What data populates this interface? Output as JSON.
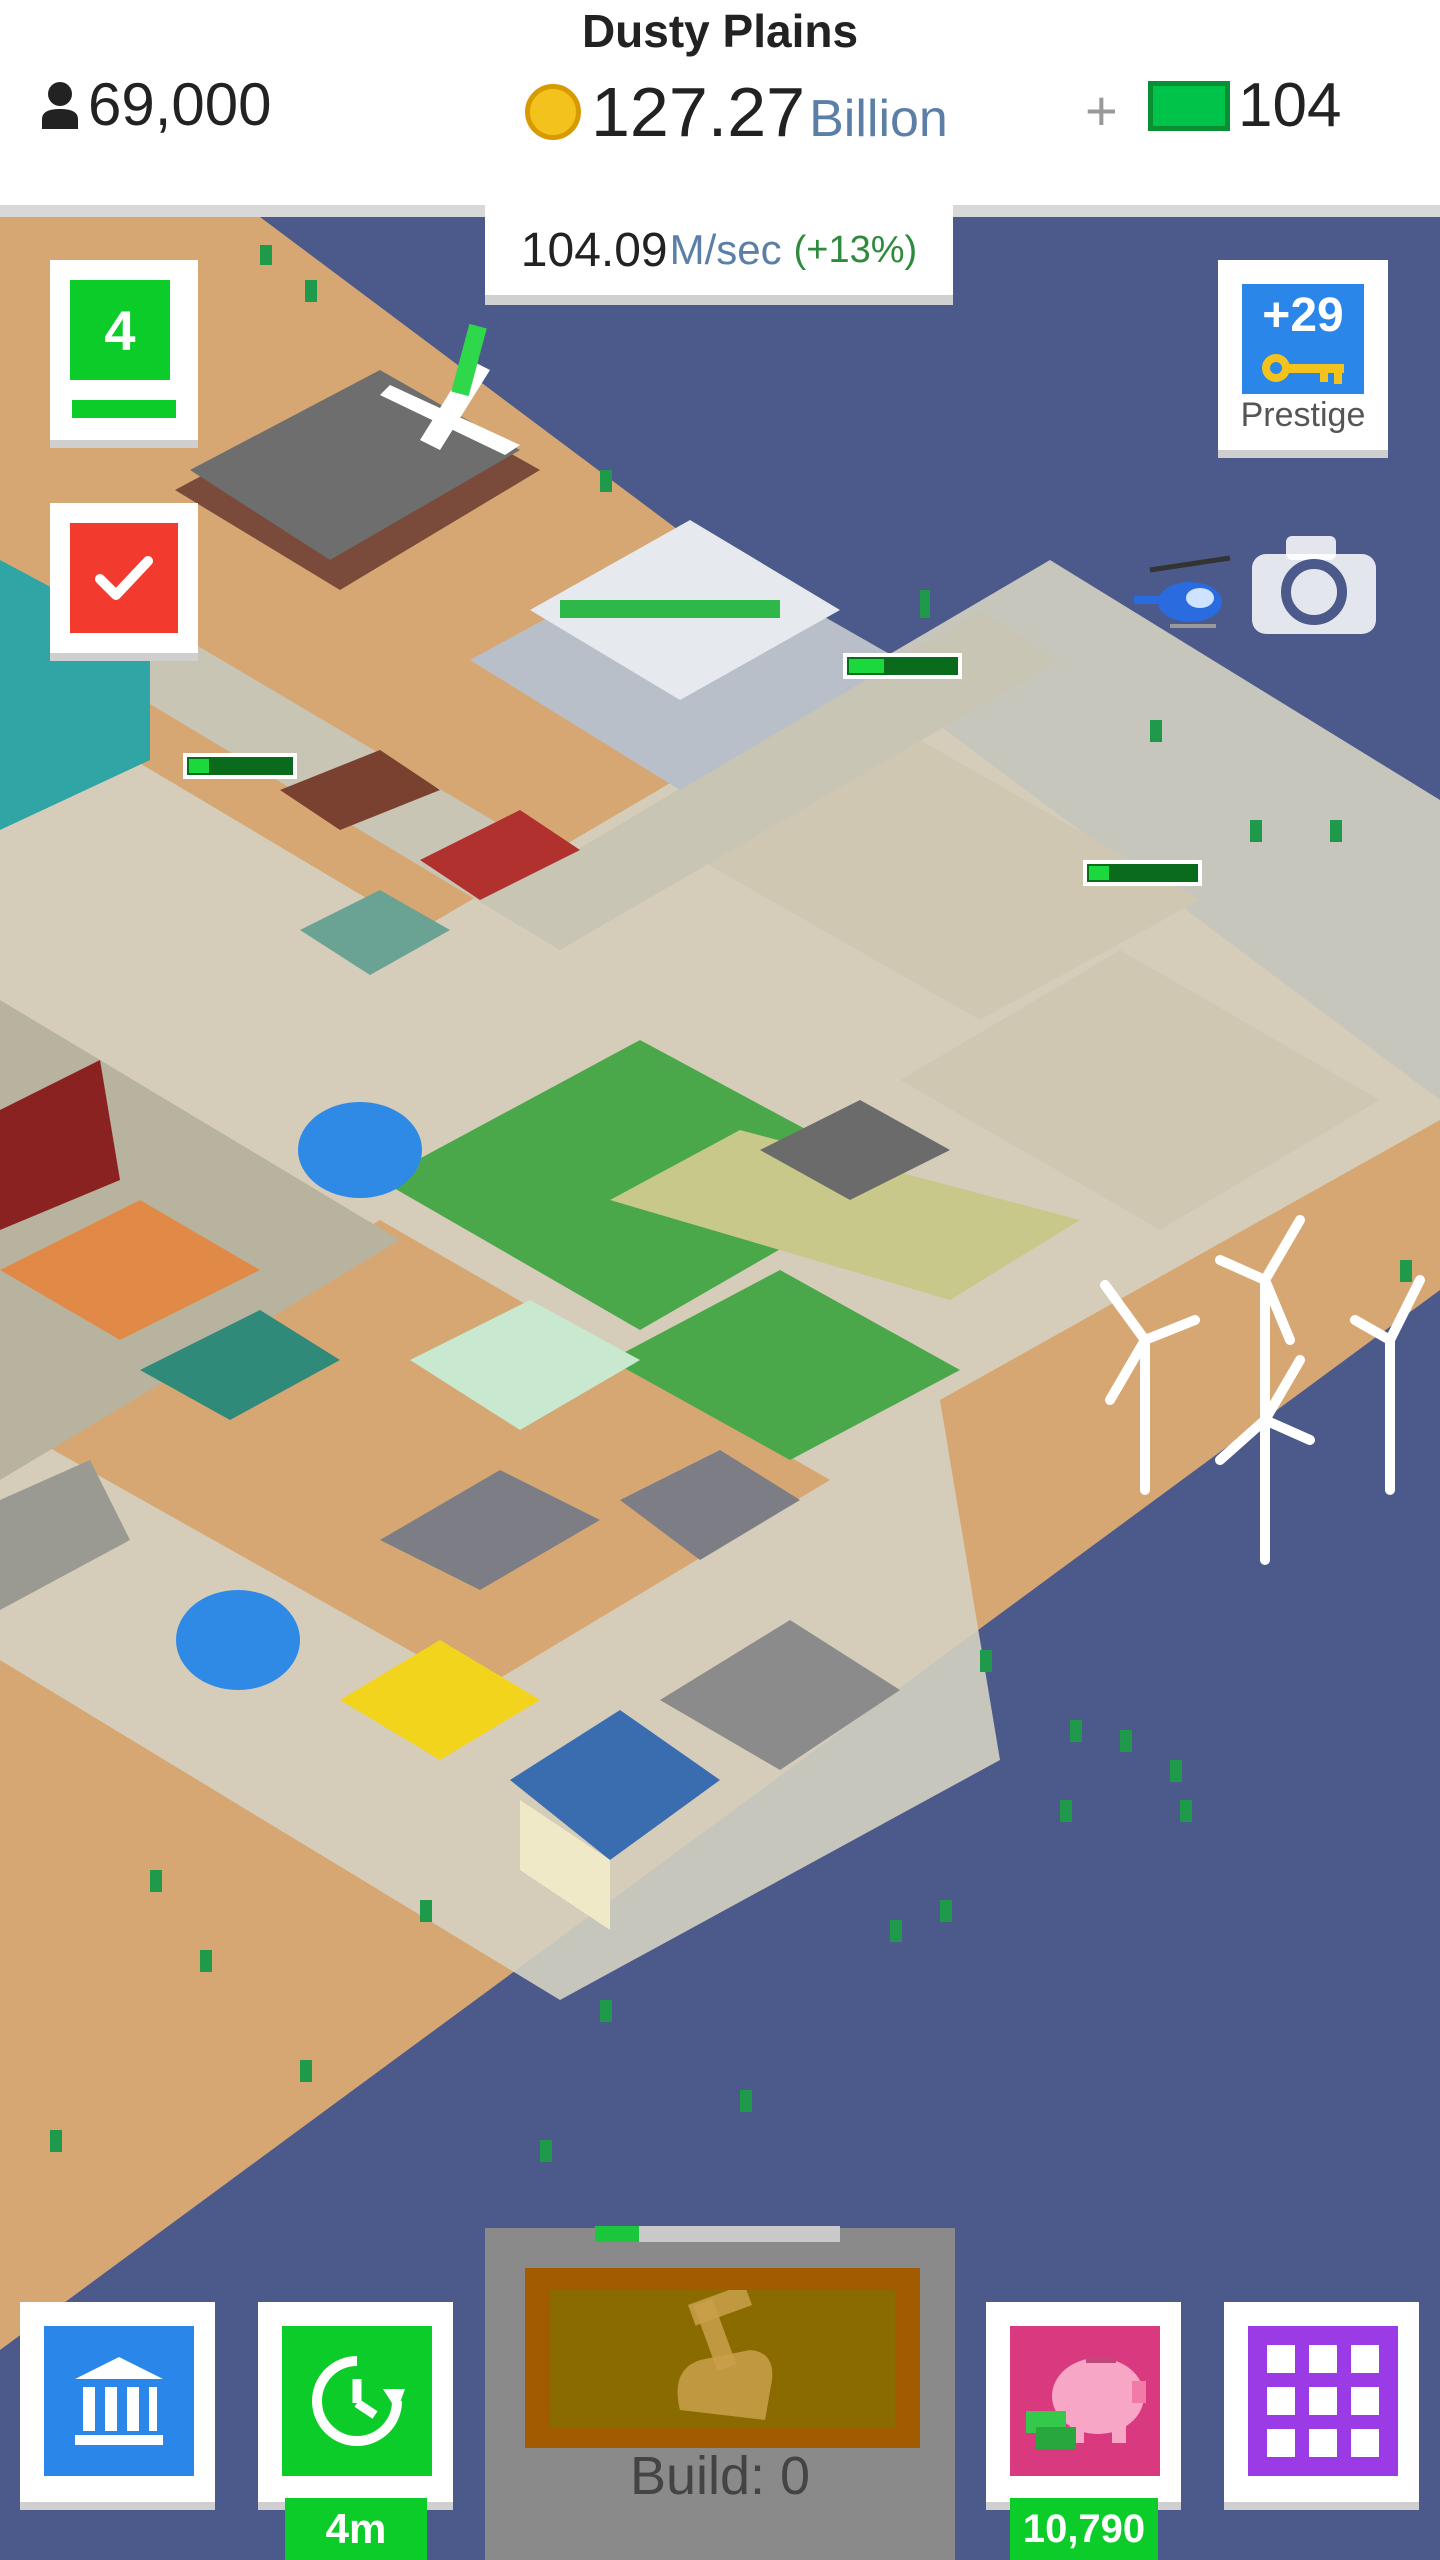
{
  "header": {
    "city_name": "Dusty Plains",
    "population": "69,000",
    "coins_value": "127.27",
    "coins_unit": "Billion",
    "plus_label": "+",
    "cash_value": "104"
  },
  "income": {
    "rate_value": "104.09",
    "rate_unit": "M/sec",
    "rate_bonus": "(+13%)"
  },
  "left_panel": {
    "level": "4",
    "level_progress": 1.0
  },
  "prestige": {
    "keys": "+29",
    "label": "Prestige"
  },
  "bottom_bar": {
    "timer_label": "4m",
    "build_label": "Build: 0",
    "build_progress": 0.18,
    "piggy_bank_value": "10,790"
  },
  "colors": {
    "sky_bg": "#4b5a8a",
    "desert": "#d6a772",
    "dirt_lot": "#a66c30",
    "road": "#d5d1c2",
    "green_accent": "#0ccc2a",
    "blue_accent": "#2a86e8",
    "red_accent": "#f23a2e",
    "purple_accent": "#9b3be6",
    "pink_accent": "#d9397e"
  }
}
